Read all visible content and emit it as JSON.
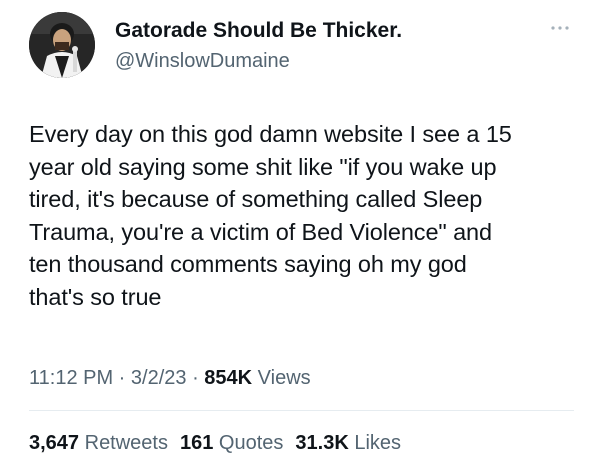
{
  "user": {
    "display_name": "Gatorade Should Be Thicker.",
    "handle": "@WinslowDumaine"
  },
  "tweet": {
    "text": "Every day on this god damn website I see a 15\nyear old saying some shit like \"if you wake up\ntired, it's because of something called Sleep\nTrauma, you're a victim of Bed Violence\" and\nten thousand comments saying oh my god\nthat's so true"
  },
  "meta": {
    "time": "11:12 PM",
    "sep1": " · ",
    "date": "3/2/23",
    "sep2": " · ",
    "views_count": "854K",
    "views_label": " Views"
  },
  "stats": {
    "retweets_count": "3,647",
    "retweets_label": " Retweets",
    "quotes_count": "161",
    "quotes_label": " Quotes",
    "likes_count": "31.3K",
    "likes_label": " Likes"
  },
  "icons": {
    "more": "more-dots-icon"
  },
  "colors": {
    "text_primary": "#0f1419",
    "text_secondary": "#536471",
    "divider": "#e6ecf0"
  }
}
